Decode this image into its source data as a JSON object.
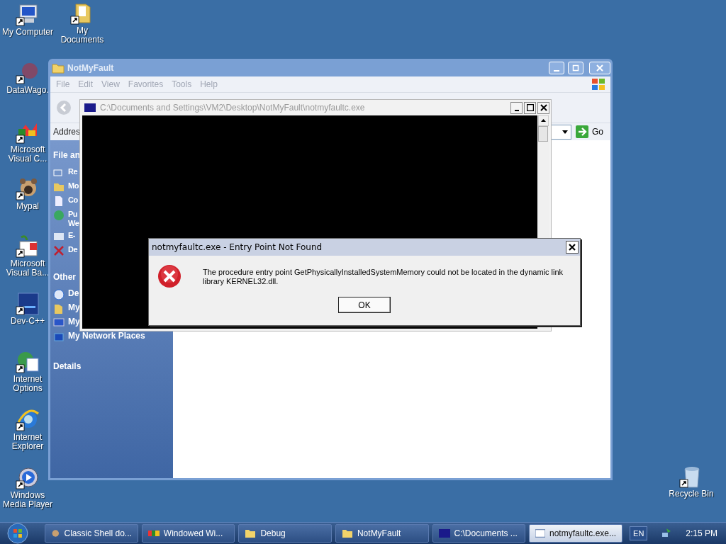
{
  "desktop_icons": [
    {
      "label": "My Computer"
    },
    {
      "label": "My Documents"
    },
    {
      "label": "DataWago."
    },
    {
      "label": "Microsoft Visual C..."
    },
    {
      "label": "Mypal"
    },
    {
      "label": "Microsoft Visual Ba..."
    },
    {
      "label": "Dev-C++"
    },
    {
      "label": "Internet Options"
    },
    {
      "label": "Internet Explorer"
    },
    {
      "label": "Windows Media Player"
    },
    {
      "label": "Recycle Bin"
    }
  ],
  "explorer": {
    "title": "NotMyFault",
    "menu": [
      "File",
      "Edit",
      "View",
      "Favorites",
      "Tools",
      "Help"
    ],
    "address_label": "Addres",
    "go_label": "Go",
    "tasks_title": "File an",
    "tasks": [
      {
        "label": "Re"
      },
      {
        "label": "Mo"
      },
      {
        "label": "Co"
      },
      {
        "label": "Pu We"
      },
      {
        "label": "E-"
      },
      {
        "label": "De"
      }
    ],
    "places_title": "Other",
    "places": [
      {
        "label": "De"
      },
      {
        "label": "My"
      },
      {
        "label": "My"
      },
      {
        "label": "My Network Places"
      }
    ],
    "details_title": "Details"
  },
  "console": {
    "title": "C:\\Documents and Settings\\VM2\\Desktop\\NotMyFault\\notmyfaultc.exe"
  },
  "dialog": {
    "title": "notmyfaultc.exe - Entry Point Not Found",
    "message": "The procedure entry point GetPhysicallyInstalledSystemMemory could not be located in the dynamic link library KERNEL32.dll.",
    "button": "OK"
  },
  "taskbar": {
    "buttons": [
      {
        "label": "Classic Shell do...",
        "selected": false
      },
      {
        "label": "Windowed Wi...",
        "selected": false
      },
      {
        "label": "Debug",
        "selected": false
      },
      {
        "label": "NotMyFault",
        "selected": false
      },
      {
        "label": "C:\\Documents ...",
        "selected": false
      },
      {
        "label": "notmyfaultc.exe...",
        "selected": true
      }
    ],
    "language": "EN",
    "clock": "2:15 PM"
  }
}
